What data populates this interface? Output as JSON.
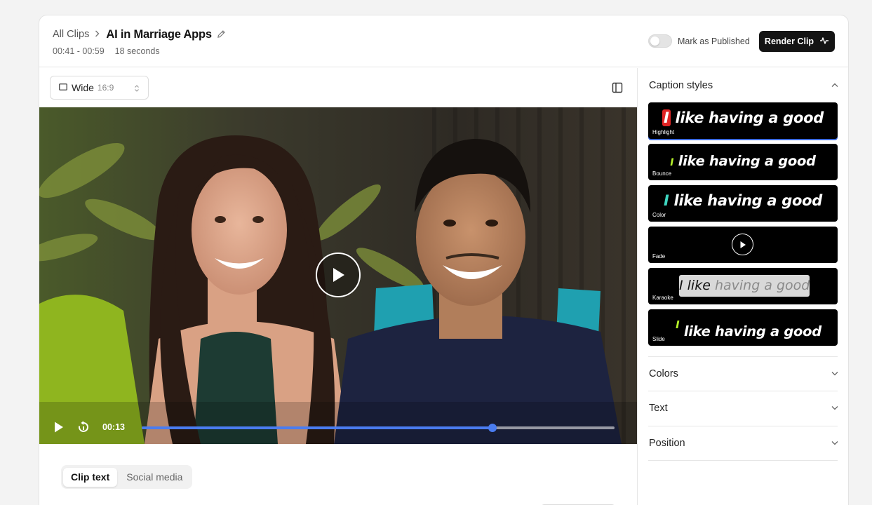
{
  "header": {
    "breadcrumb_root": "All Clips",
    "title": "AI in Marriage Apps",
    "time_range": "00:41 - 00:59",
    "duration": "18 seconds",
    "publish_toggle_label": "Mark as Published",
    "publish_toggle_on": false,
    "render_button": "Render Clip"
  },
  "player": {
    "aspect_name": "Wide",
    "aspect_ratio": "16:9",
    "current_time": "00:13",
    "progress": 0.742
  },
  "tabs": [
    {
      "label": "Clip text",
      "active": true
    },
    {
      "label": "Social media",
      "active": false
    }
  ],
  "sidebar": {
    "caption_styles_title": "Caption styles",
    "sample_first_word": "I",
    "sample_rest": "like having a good",
    "karaoke_done": "I like",
    "karaoke_rest": "having a good",
    "styles": [
      {
        "label": "Highlight",
        "selected": true
      },
      {
        "label": "Bounce",
        "selected": false
      },
      {
        "label": "Color",
        "selected": false
      },
      {
        "label": "Fade",
        "selected": false
      },
      {
        "label": "Karaoke",
        "selected": false
      },
      {
        "label": "Slide",
        "selected": false
      }
    ],
    "sections": [
      "Colors",
      "Text",
      "Position"
    ]
  },
  "colors": {
    "accent": "#4a7cf0",
    "highlight_red": "#e02424",
    "bounce_green": "#b6f22a",
    "color_teal": "#3ed6c0"
  }
}
